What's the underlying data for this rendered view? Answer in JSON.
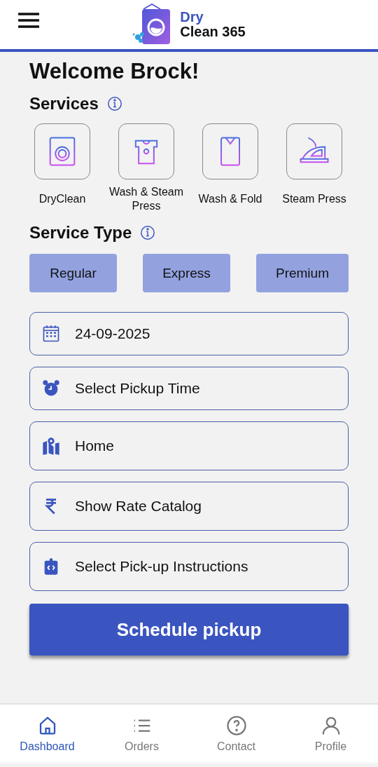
{
  "header": {
    "brand_line1": "Dry",
    "brand_line2": "Clean 365"
  },
  "greeting": "Welcome Brock!",
  "services": {
    "title": "Services",
    "items": [
      {
        "kind": "washer",
        "label": "DryClean"
      },
      {
        "kind": "tshirt",
        "label": "Wash & Steam Press"
      },
      {
        "kind": "shirt",
        "label": "Wash & Fold"
      },
      {
        "kind": "iron",
        "label": "Steam Press"
      }
    ]
  },
  "service_type": {
    "title": "Service Type",
    "options": [
      "Regular",
      "Express",
      "Premium"
    ]
  },
  "fields": [
    {
      "kind": "calendar",
      "value": "24-09-2025"
    },
    {
      "kind": "alarm",
      "value": "Select Pickup Time"
    },
    {
      "kind": "map",
      "value": "Home"
    },
    {
      "kind": "rupee",
      "value": "Show Rate Catalog"
    },
    {
      "kind": "clipboard",
      "value": "Select Pick-up Instructions"
    }
  ],
  "primary_button": "Schedule pickup",
  "bottom_nav": [
    {
      "kind": "home",
      "label": "Dashboard",
      "selected": true
    },
    {
      "kind": "list",
      "label": "Orders",
      "selected": false
    },
    {
      "kind": "help",
      "label": "Contact",
      "selected": false
    },
    {
      "kind": "person",
      "label": "Profile",
      "selected": false
    }
  ]
}
